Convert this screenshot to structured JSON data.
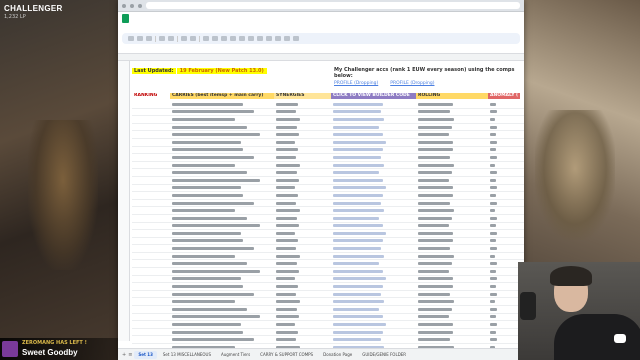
{
  "stream": {
    "rank_title": "CHALLENGER",
    "rank_sub": "1,232 LP",
    "notification": {
      "top": "ZEROMANG HAS LEFT !",
      "main": "Sweet Goodby"
    }
  },
  "sheet": {
    "last_updated_label": "Last Updated:",
    "last_updated_value": "19 February (New Patch 13.0)",
    "challenger_title": "My Challenger accs (rank 1 EUW every season) using the comps below:",
    "challenger_links": [
      "PROFILE (Dropping)",
      "PROFILE (Dropping)"
    ],
    "headers": {
      "ranking": "RANKING",
      "carries": "CARRIES (best itemsp + main carry)",
      "synergies": "SYNERGIES",
      "builder": "CLICK TO VIEW BUILDER CODE",
      "rolling": "ROLLING",
      "anomaly": "ANOMALY ("
    },
    "row_count": 34,
    "tabs": [
      "Set 13",
      "Set 13 MISCELLANEOUS",
      "Augment Tiers",
      "CARRY & SUPPORT COMPS",
      "Donation Page",
      "GUIDE/GENIE FOLDER"
    ],
    "active_tab_index": 0
  },
  "colors": {
    "header_carries": "#ffd966",
    "header_builder": "#8e7cc3",
    "header_anomaly": "#e06666",
    "highlight": "#ffff00"
  }
}
